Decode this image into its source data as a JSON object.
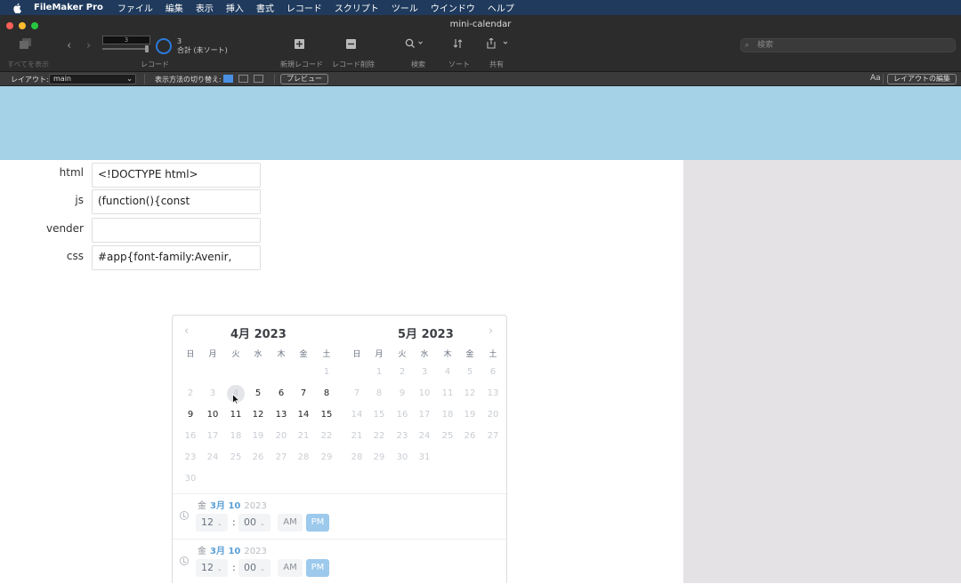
{
  "menubar": {
    "app_name": "FileMaker Pro",
    "items": [
      "ファイル",
      "編集",
      "表示",
      "挿入",
      "書式",
      "レコード",
      "スクリプト",
      "ツール",
      "ウインドウ",
      "ヘルプ"
    ]
  },
  "window": {
    "title": "mini-calendar"
  },
  "toolbar": {
    "show_all_label": "すべてを表示",
    "record_label": "レコード",
    "record_number": "3",
    "record_count": "3",
    "record_status": "合計 (未ソート)",
    "new_record_label": "新規レコード",
    "delete_record_label": "レコード削除",
    "find_label": "検索",
    "sort_label": "ソート",
    "share_label": "共有",
    "search_placeholder": "検索"
  },
  "layoutbar": {
    "layout_label": "レイアウト:",
    "layout_value": "main",
    "view_as_label": "表示方法の切り替え:",
    "preview_label": "プレビュー",
    "edit_layout_label": "レイアウトの編集",
    "text_size_icon": "Aa"
  },
  "fields": [
    {
      "label": "html",
      "value": "<!DOCTYPE html>"
    },
    {
      "label": "js",
      "value": "(function(){const"
    },
    {
      "label": "vender",
      "value": ""
    },
    {
      "label": "css",
      "value": "#app{font-family:Avenir,"
    }
  ],
  "calendar": {
    "weekdays": [
      "日",
      "月",
      "火",
      "水",
      "木",
      "金",
      "土"
    ],
    "months": [
      {
        "title": "4月 2023",
        "days": [
          "1",
          "2",
          "3",
          "4",
          "5",
          "6",
          "7",
          "8",
          "9",
          "10",
          "11",
          "12",
          "13",
          "14",
          "15",
          "16",
          "17",
          "18",
          "19",
          "20",
          "21",
          "22",
          "23",
          "24",
          "25",
          "26",
          "27",
          "28",
          "29",
          "30"
        ]
      },
      {
        "title": "5月 2023",
        "days": [
          "1",
          "2",
          "3",
          "4",
          "5",
          "6",
          "7",
          "8",
          "9",
          "10",
          "11",
          "12",
          "13",
          "14",
          "15",
          "16",
          "17",
          "18",
          "19",
          "20",
          "21",
          "22",
          "23",
          "24",
          "25",
          "26",
          "27",
          "28",
          "29",
          "30",
          "31"
        ]
      }
    ],
    "nav_prev": "‹",
    "nav_next": "›",
    "time_rows": [
      {
        "weekday": "金",
        "month_day": "3月 10",
        "year": "2023",
        "hour": "12",
        "minute": "00",
        "am": "AM",
        "pm": "PM"
      },
      {
        "weekday": "金",
        "month_day": "3月 10",
        "year": "2023",
        "hour": "12",
        "minute": "00",
        "am": "AM",
        "pm": "PM"
      }
    ]
  },
  "colors": {
    "header_band": "#a5d2e6",
    "side_panel": "#e4e2e4",
    "accent_pm": "#9cc9ec",
    "date_accent": "#5a9fd6"
  }
}
